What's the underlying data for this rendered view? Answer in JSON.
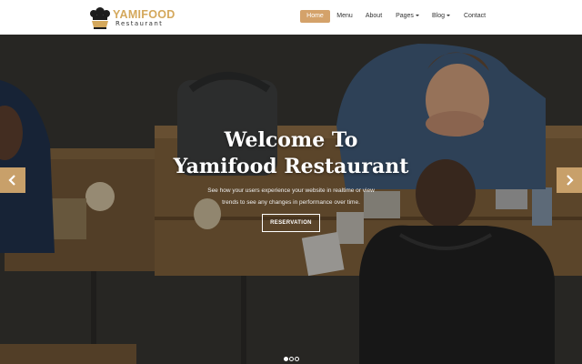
{
  "brand": {
    "name": "YAMIFOOD",
    "tagline": "Restaurant",
    "color": "#d4a85c"
  },
  "nav": {
    "items": [
      {
        "label": "Home",
        "active": true
      },
      {
        "label": "Menu"
      },
      {
        "label": "About"
      },
      {
        "label": "Pages",
        "dropdown": true
      },
      {
        "label": "Blog",
        "dropdown": true
      },
      {
        "label": "Contact"
      }
    ],
    "accent": "#d4a26a"
  },
  "hero": {
    "title_line1": "Welcome To",
    "title_line2": "Yamifood Restaurant",
    "text_line1": "See how your users experience your website in realtime or view",
    "text_line2": "trends to see any changes in performance over time.",
    "button_label": "RESERVATION",
    "prev_icon": "chevron-left-icon",
    "next_icon": "chevron-right-icon",
    "slides_total": 3,
    "active_slide": 1
  }
}
